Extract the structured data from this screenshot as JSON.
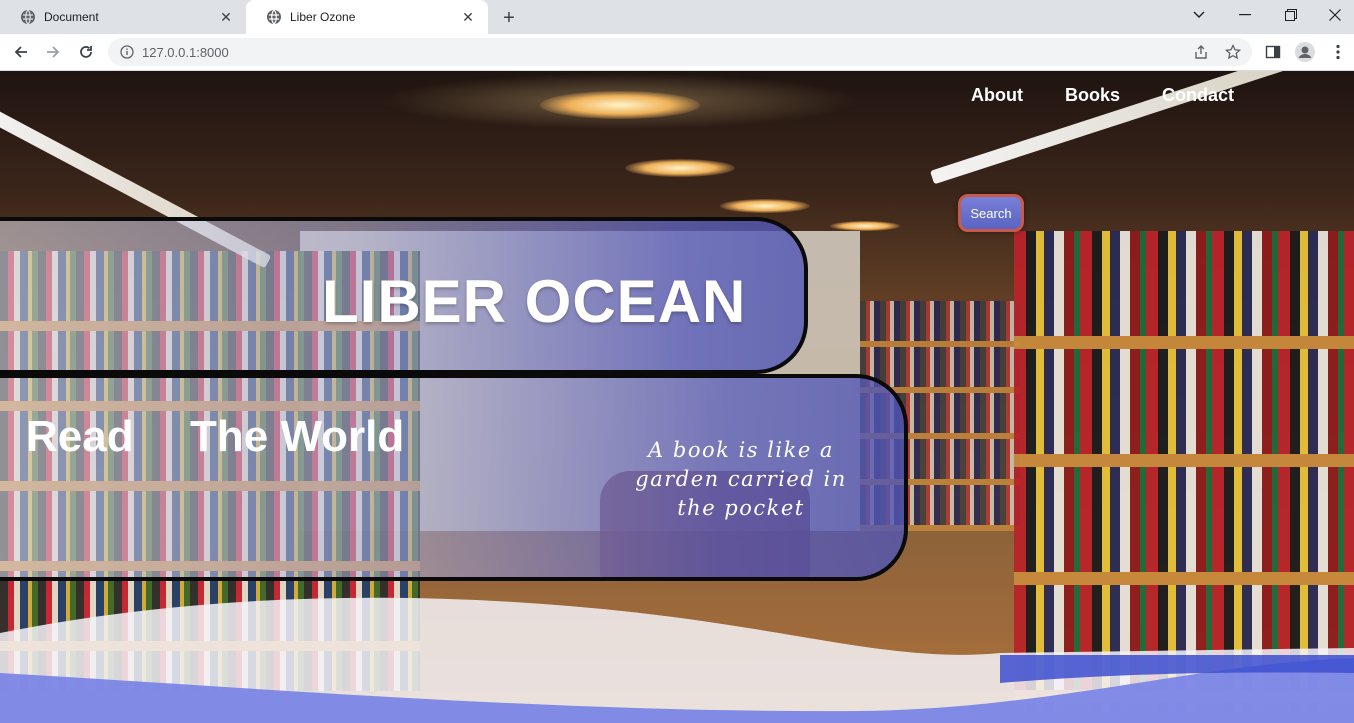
{
  "browser": {
    "tabs": [
      {
        "title": "Document",
        "active": false
      },
      {
        "title": "Liber Ozone",
        "active": true
      }
    ],
    "url": "127.0.0.1:8000"
  },
  "site": {
    "nav": [
      "About",
      "Books",
      "Condact"
    ],
    "search_label": "Search",
    "hero_title": "LIBER OCEAN",
    "tagline_word1": "Read",
    "tagline_word2": "The World",
    "quote": "A book is like a garden carried in the pocket"
  },
  "colors": {
    "panel_accent": "#5b63c4",
    "search_border": "#c75a4a",
    "wave_blue": "#7b86e6",
    "wave_white": "#f4f3f8"
  }
}
